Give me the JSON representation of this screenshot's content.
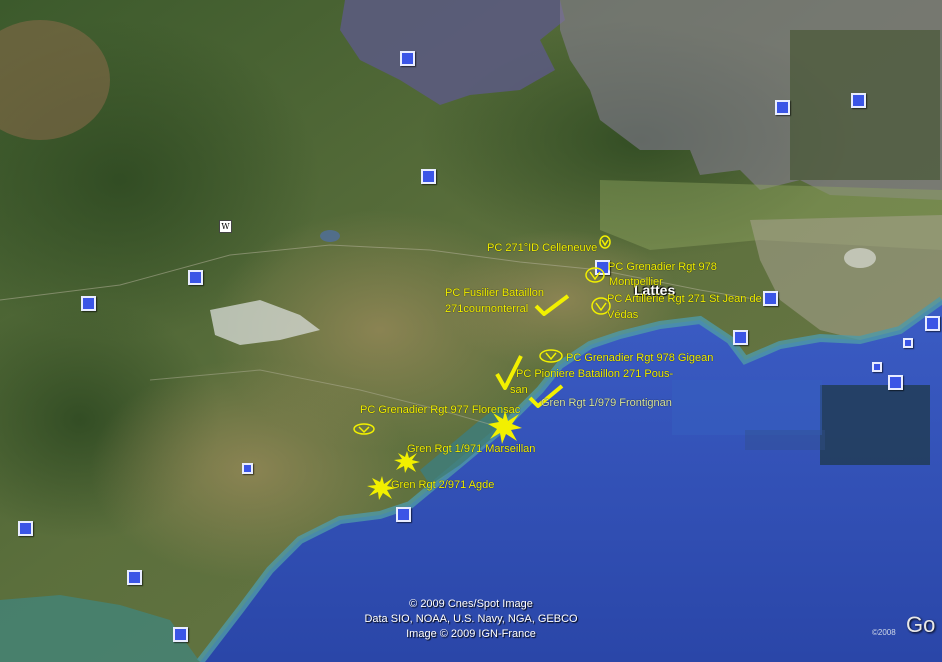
{
  "city_label": "Lattes",
  "labels": {
    "pc_271id": "PC  271°ID Celleneuve",
    "pc_gren978_montpellier_1": "PC Grenadier Rgt  978",
    "pc_gren978_montpellier_2": "Montpellier",
    "pc_fusilier_1": "PC Fusilier Bataillon",
    "pc_fusilier_2": "271cournonterral",
    "pc_artillerie_1": "PC Artillerie Rgt  271 St Jean de",
    "pc_artillerie_2": "Védas",
    "pc_gren978_gigean": "PC Grenadier Rgt 978 Gigean",
    "pc_pioniere_1": "PC Pioniere Bataillon 271 Pous-",
    "pc_pioniere_2": "san",
    "gren_1979": "Gren Rgt 1/979 Frontignan",
    "pc_gren977": "PC Grenadier Rgt  977 Florensac",
    "gren_1971": "Gren Rgt 1/971 Marseillan",
    "gren_2971": "Gren Rgt 2/971 Agde"
  },
  "credits": {
    "line1": "© 2009 Cnes/Spot Image",
    "line2": "Data SIO, NOAA, U.S. Navy, NGA, GEBCO",
    "line3": "Image © 2009 IGN-France"
  },
  "copyright_small": "©2008",
  "logo_text": "Go",
  "wiki_symbol": "W",
  "colors": {
    "label_yellow": "#f2f000",
    "sea": "#2f4fb8",
    "land": "#4a6a35",
    "pin_blue": "#3b55e6"
  },
  "icons": {
    "photo_pin": "blue-square-icon",
    "checkmark": "checkmark-icon",
    "explosion": "star-burst-icon",
    "command_post": "ellipse-v-icon"
  }
}
